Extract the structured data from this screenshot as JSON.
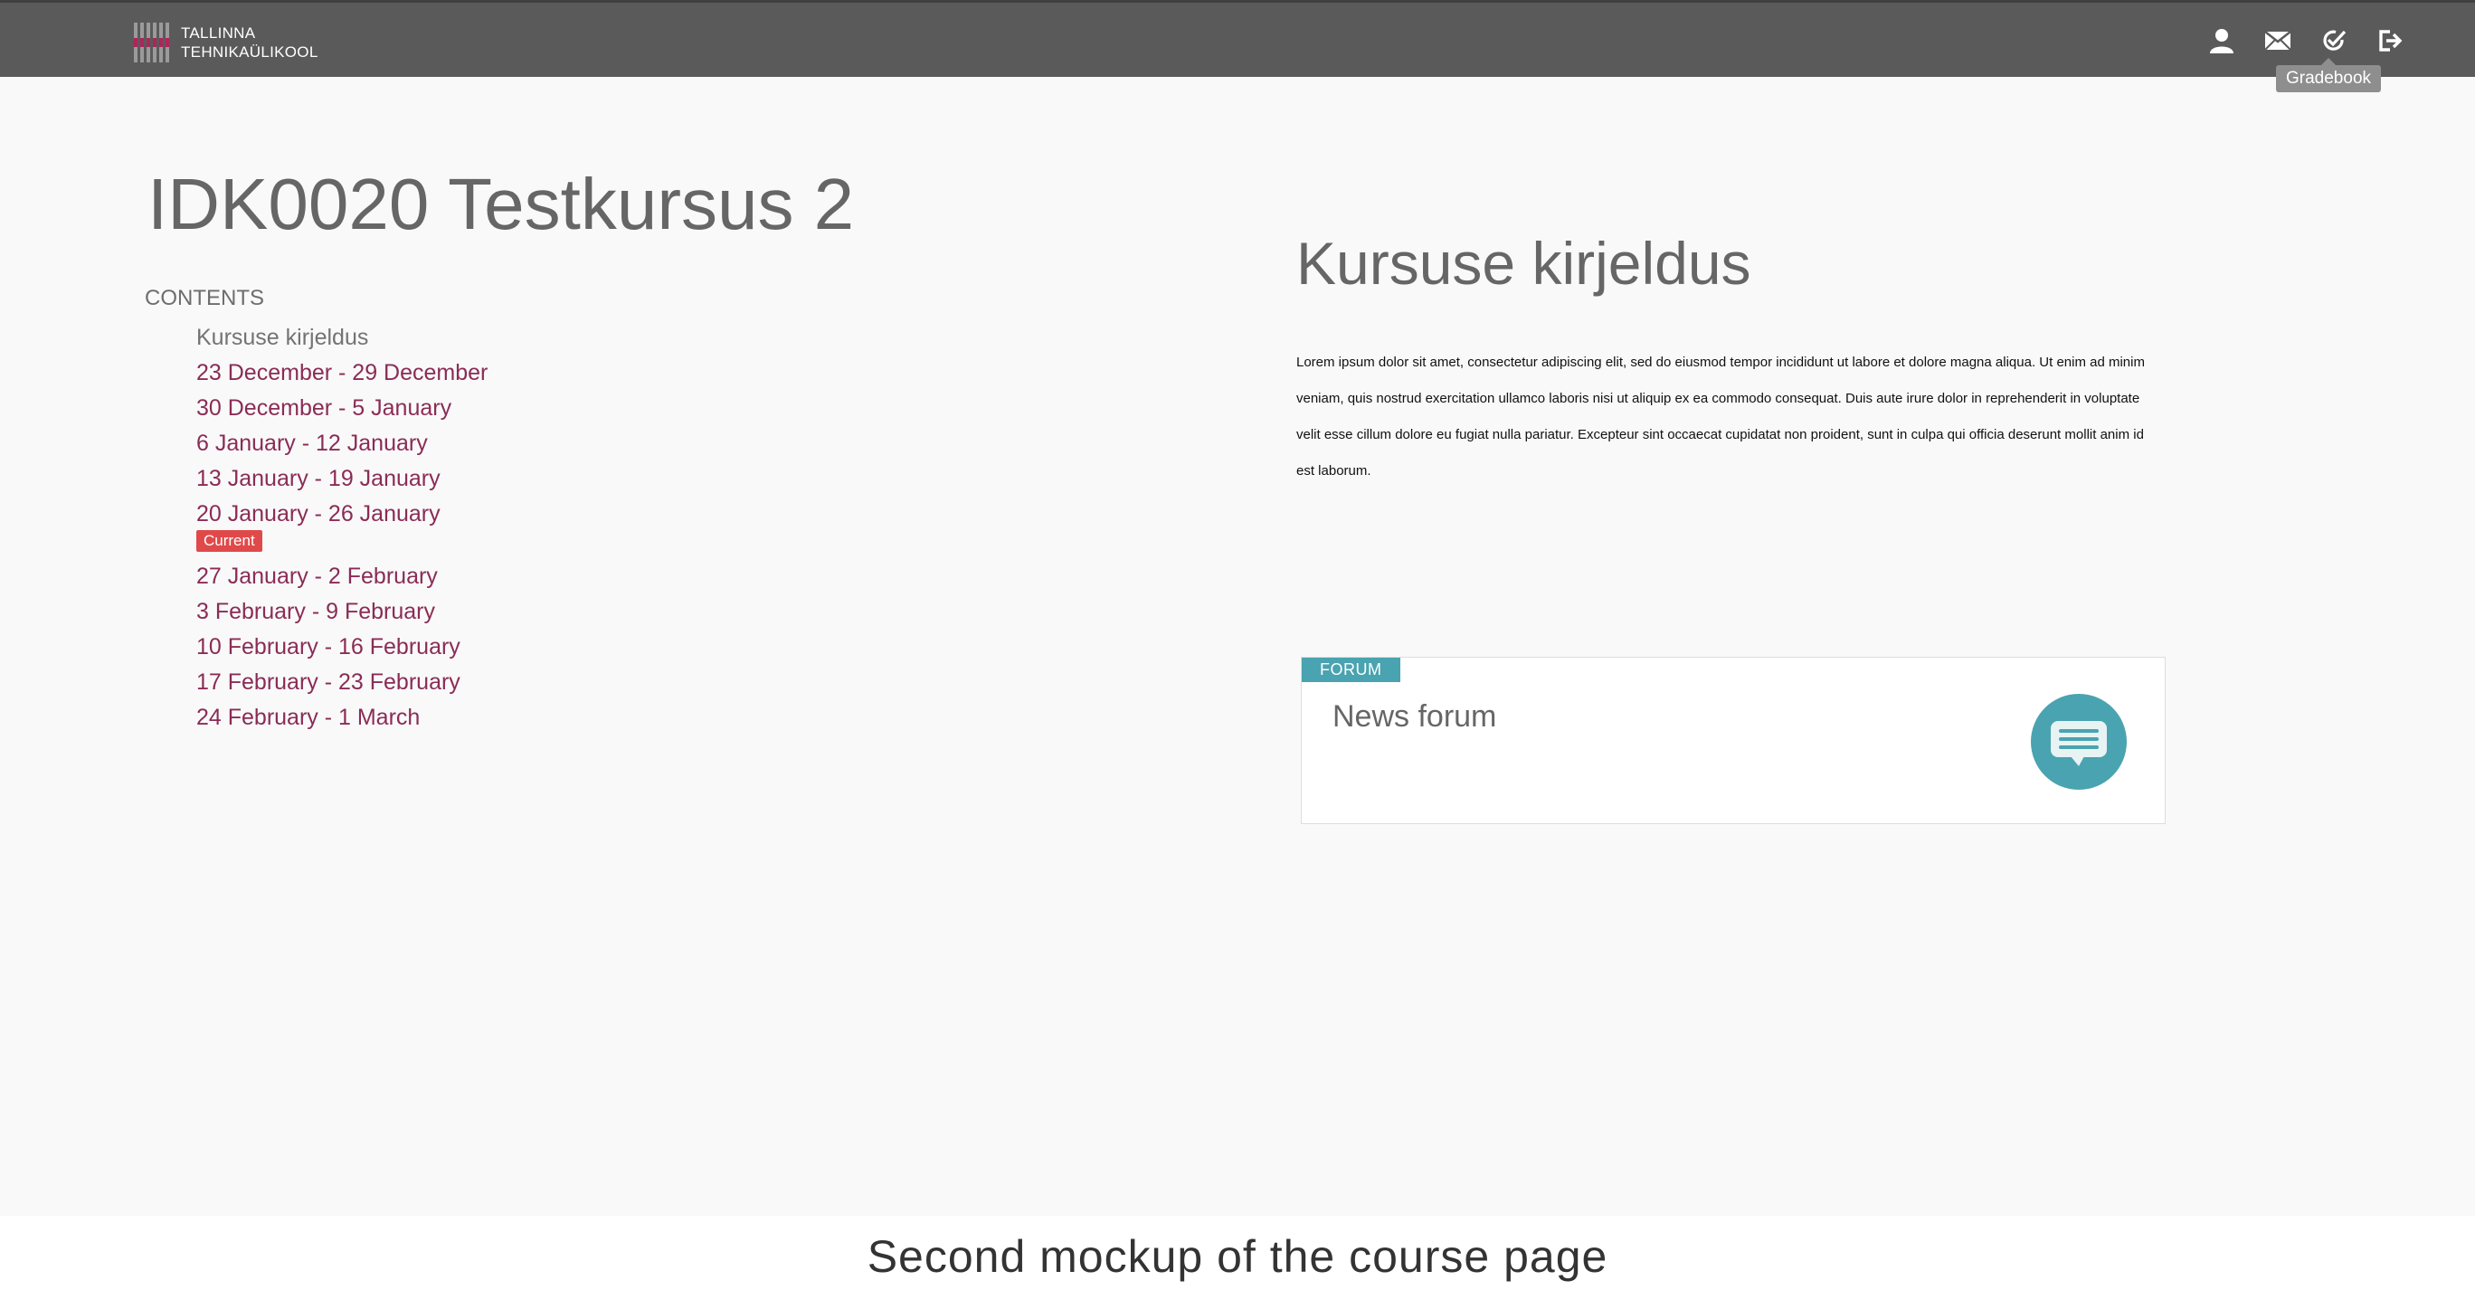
{
  "header": {
    "logo_line1": "TALLINNA",
    "logo_line2": "TEHNIKAÜLIKOOL",
    "tooltip": "Gradebook",
    "icons": [
      "user-icon",
      "mail-icon",
      "gradebook-icon",
      "logout-icon"
    ]
  },
  "course": {
    "title": "IDK0020 Testkursus 2",
    "contents_label": "CONTENTS",
    "toc": [
      "Kursuse kirjeldus",
      "23 December - 29 December",
      "30 December - 5 January",
      "6 January - 12 January",
      "13 January - 19 January",
      "20 January - 26 January",
      "27 January - 2 February",
      "3 February - 9 February",
      "10 February - 16 February",
      "17 February - 23 February",
      "24 February - 1 March"
    ],
    "current_badge": "Current"
  },
  "section": {
    "title": "Kursuse kirjeldus",
    "description": "Lorem ipsum dolor sit amet, consectetur adipiscing elit, sed do eiusmod tempor incididunt ut labore et dolore magna aliqua. Ut enim ad minim veniam, quis nostrud exercitation ullamco laboris nisi ut aliquip ex ea commodo consequat. Duis aute irure dolor in reprehenderit in voluptate velit esse cillum dolore eu fugiat nulla pariatur. Excepteur sint occaecat cupidatat non proident, sunt in culpa qui officia deserunt mollit anim id est laborum."
  },
  "forum": {
    "tag": "FORUM",
    "name": "News forum",
    "icon": "chat-bubble-icon"
  },
  "caption": "Second mockup of the course page",
  "colors": {
    "topbar": "#5a5a5a",
    "link": "#8a2c56",
    "badge": "#e0494a",
    "forum_accent": "#4aa3b0"
  }
}
